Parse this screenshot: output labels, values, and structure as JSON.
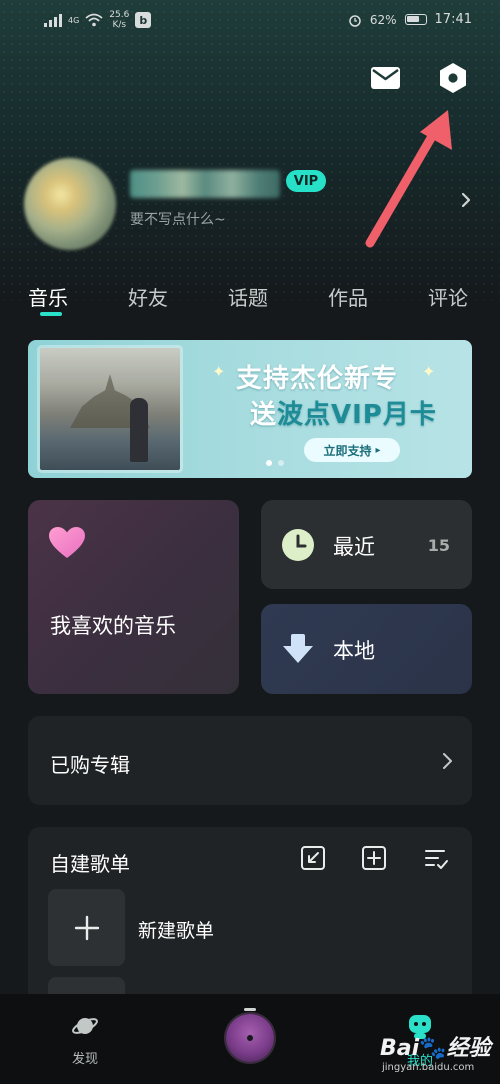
{
  "status_bar": {
    "network": "4G",
    "speed_value": "25.6",
    "speed_unit": "K/s",
    "app_icon_letter": "b",
    "battery": "62%",
    "time": "17:41"
  },
  "profile": {
    "vip_label": "VIP",
    "bio": "要不写点什么~"
  },
  "tabs": [
    {
      "label": "音乐",
      "active": true
    },
    {
      "label": "好友",
      "active": false
    },
    {
      "label": "话题",
      "active": false
    },
    {
      "label": "作品",
      "active": false
    },
    {
      "label": "评论",
      "active": false
    }
  ],
  "banner": {
    "line1": "支持杰伦新专",
    "line2_prefix": "送",
    "line2_highlight": "波点VIP月卡",
    "button_label": "立即支持",
    "button_arrow": "▸",
    "page_count": 2,
    "active_page": 1
  },
  "cards": {
    "favorites_label": "我喜欢的音乐",
    "recent_label": "最近",
    "recent_count": "15",
    "local_label": "本地"
  },
  "purchased": {
    "label": "已购专辑"
  },
  "playlists": {
    "title": "自建歌单",
    "new_label": "新建歌单"
  },
  "bottom_nav": {
    "discover_label": "发现",
    "mine_label": "我的"
  },
  "watermark": {
    "logo_left": "Bai",
    "logo_paw": "🐾",
    "logo_right": "经验",
    "url": "jingyan.baidu.com"
  },
  "colors": {
    "accent": "#2be0c8",
    "arrow": "#f0606a",
    "background": "#15191c"
  }
}
